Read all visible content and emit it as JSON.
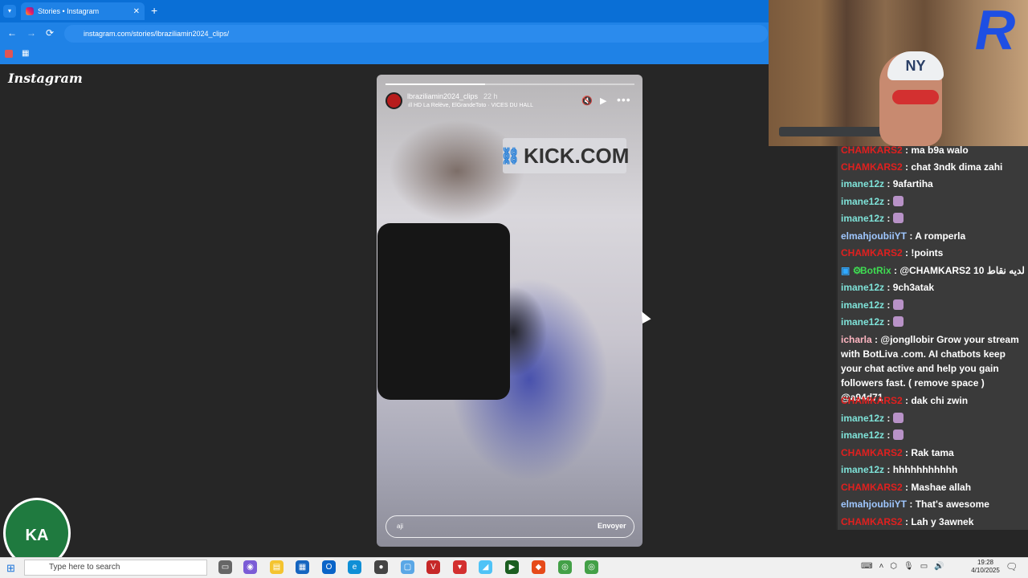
{
  "browser": {
    "tab_title": "Stories • Instagram",
    "tab_close": "✕",
    "new_tab": "+",
    "url": "instagram.com/stories/lbraziliamin2024_clips/",
    "back": "←",
    "forward": "→",
    "reload": "⟳"
  },
  "instagram": {
    "logo": "Instagram",
    "story": {
      "username": "lbraziliamin2024_clips",
      "time": "22 h",
      "music": "HD La Relève, ElGrandeToto · VICES DU HALL",
      "progress": 0.4,
      "overlay_text": "KICK.COM",
      "reply_value": "aji",
      "send_label": "Envoyer"
    }
  },
  "webcam": {
    "cap_text": "NY"
  },
  "chat": {
    "colors": {
      "red": "#e0201f",
      "teal": "#7fe3d9",
      "blue": "#9fc7ff",
      "green": "#3fdc52",
      "pink": "#ffb6c1"
    },
    "messages": [
      {
        "user": "CHAMKARS2",
        "text": "ma b9a walo",
        "color": "red"
      },
      {
        "user": "CHAMKARS2",
        "text": "chat 3ndk dima zahi",
        "color": "red"
      },
      {
        "user": "imane12z",
        "text": "9afartiha",
        "color": "teal"
      },
      {
        "user": "imane12z",
        "text": "",
        "color": "teal",
        "emote": true
      },
      {
        "user": "imane12z",
        "text": "",
        "color": "teal",
        "emote": true
      },
      {
        "user": "elmahjoubiiYT",
        "text": "A romperla",
        "color": "blue"
      },
      {
        "user": "CHAMKARS2",
        "text": "!points",
        "color": "red"
      },
      {
        "user": "BotRix",
        "text": "@CHAMKARS2 10 لديه نقاط",
        "color": "green",
        "badges": true
      },
      {
        "user": "imane12z",
        "text": "9ch3atak",
        "color": "teal"
      },
      {
        "user": "imane12z",
        "text": "",
        "color": "teal",
        "emote": true
      },
      {
        "user": "imane12z",
        "text": "",
        "color": "teal",
        "emote": true
      },
      {
        "user": "icharla",
        "text": "@jongllobir Grow your stream with BotLiva .com. AI chatbots keep your chat active and help you gain followers fast. ( remove space ) @a94d71",
        "color": "pink",
        "wrap": true
      },
      {
        "user": "CHAMKARS2",
        "text": "dak chi zwin",
        "color": "red"
      },
      {
        "user": "imane12z",
        "text": "",
        "color": "teal",
        "emote": true
      },
      {
        "user": "imane12z",
        "text": "",
        "color": "teal",
        "emote": true
      },
      {
        "user": "CHAMKARS2",
        "text": "Rak tama",
        "color": "red"
      },
      {
        "user": "imane12z",
        "text": "hhhhhhhhhhh",
        "color": "teal"
      },
      {
        "user": "CHAMKARS2",
        "text": "Mashae allah",
        "color": "red"
      },
      {
        "user": "elmahjoubiiYT",
        "text": "That's awesome",
        "color": "blue"
      },
      {
        "user": "CHAMKARS2",
        "text": "Lah y 3awnek",
        "color": "red"
      }
    ]
  },
  "channel_logo": "KA",
  "taskbar": {
    "search_placeholder": "Type here to search",
    "time": "19:28",
    "date": "4/10/2025"
  }
}
